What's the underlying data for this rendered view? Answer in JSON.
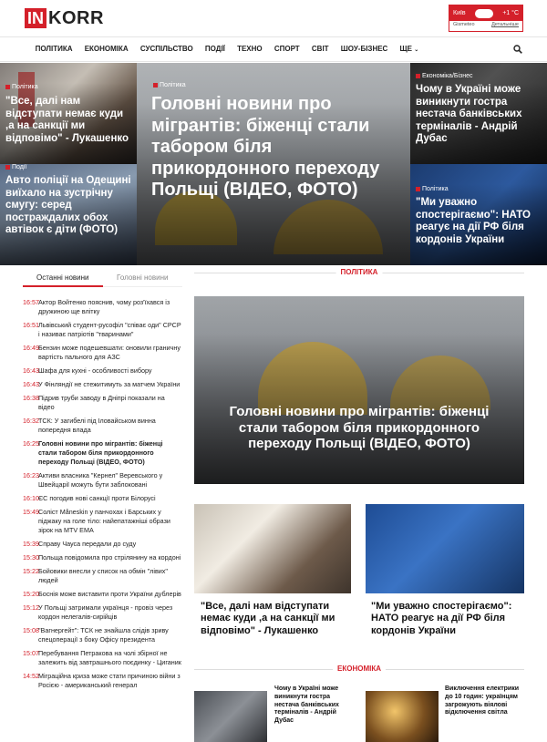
{
  "header": {
    "logo_in": "IN",
    "logo_korr": "KORR",
    "weather": {
      "city": "Київ",
      "temp": "+1 °C",
      "source": "Gismeteo",
      "more": "Детальніше"
    }
  },
  "nav": {
    "items": [
      "ПОЛІТИКА",
      "ЕКОНОМІКА",
      "СУСПІЛЬСТВО",
      "ПОДІЇ",
      "ТЕХНО",
      "СПОРТ",
      "СВІТ",
      "ШОУ-БІЗНЕС",
      "ЩЕ"
    ]
  },
  "hero": {
    "left_top": {
      "tag": "Політика",
      "title": "\"Все, далі нам відступати немає куди ,а на санкції ми відповімо\" - Лукашенко"
    },
    "left_bottom": {
      "tag": "Події",
      "title": "Авто поліції на Одещині виїхало на зустрічну смугу: серед постраждалих обох автівок є діти (ФОТО)"
    },
    "center": {
      "tag": "Політика",
      "title": "Головні новини про мігрантів: біженці стали табором біля прикордонного переходу Польщі (ВІДЕО, ФОТО)"
    },
    "right_top": {
      "tag": "Економіка/Бізнес",
      "title": "Чому в Україні може виникнути гостра нестача банківських терміналів - Андрій Дубас"
    },
    "right_bottom": {
      "tag": "Політика",
      "title": "\"Ми уважно спостерігаємо\": НАТО реагує на дії РФ біля кордонів України"
    }
  },
  "tabs": {
    "latest": "Останні новини",
    "main": "Головні новини"
  },
  "latest_news": [
    {
      "time": "16:57",
      "text": "Актор Войтенко пояснив, чому роз'їхався із дружиною ще влітку",
      "bold": false
    },
    {
      "time": "16:51",
      "text": "Львівський студент-русофіл \"співає оди\" СРСР і називає патріотів \"тваринами\"",
      "bold": false
    },
    {
      "time": "16:49",
      "text": "Бензин може подешевшати: оновили граничну вартість пального для АЗС",
      "bold": false
    },
    {
      "time": "16:43",
      "text": "Шафа для кухні - особливості вибору",
      "bold": false
    },
    {
      "time": "16:43",
      "text": "У Фінляндії не стежитимуть за матчем України",
      "bold": false
    },
    {
      "time": "16:38",
      "text": "Підрив труби заводу в Дніпрі показали на відео",
      "bold": false
    },
    {
      "time": "16:32",
      "text": "ТСК: У загибелі під Іловайськом винна попередня влада",
      "bold": false
    },
    {
      "time": "16:25",
      "text": "Головні новини про мігрантів: біженці стали табором біля прикордонного переходу Польщі (ВІДЕО, ФОТО)",
      "bold": true
    },
    {
      "time": "16:23",
      "text": "Активи власника \"Кернел\" Веревського у Швейцарії можуть бути заблоковані",
      "bold": false
    },
    {
      "time": "16:10",
      "text": "ЄС погодив нові санкції проти Білорусі",
      "bold": false
    },
    {
      "time": "15:49",
      "text": "Соліст Måneskin у панчохах і Барських у піджаку на голе тіло: найепатажніші образи зірок на MTV EMA",
      "bold": false
    },
    {
      "time": "15:39",
      "text": "Справу Чауса передали до суду",
      "bold": false
    },
    {
      "time": "15:30",
      "text": "Польща повідомила про стрілянину на кордоні",
      "bold": false
    },
    {
      "time": "15:22",
      "text": "Бойовики внесли у список на обмін \"лівих\" людей",
      "bold": false
    },
    {
      "time": "15:20",
      "text": "Боснія може виставити проти України дублерів",
      "bold": false
    },
    {
      "time": "15:12",
      "text": "У Польщі затримали українця - провіз через кордон нелегалів-сирійців",
      "bold": false
    },
    {
      "time": "15:08",
      "text": "\"Вагнергейт\": ТСК не знайшла слідів зриву спецоперації з боку Офісу президента",
      "bold": false
    },
    {
      "time": "15:07",
      "text": "Перебування Петракова на чолі збірної не залежить від завтрашнього поєдинку - Циганик",
      "bold": false
    },
    {
      "time": "14:52",
      "text": "Міграційна криза може стати причиною війни з Росією - американський генерал",
      "bold": false
    }
  ],
  "sections": {
    "politics": {
      "label": "ПОЛІТИКА",
      "main_title": "Головні новини про мігрантів: біженці стали табором біля прикордонного переходу Польщі (ВІДЕО, ФОТО)",
      "card1": "\"Все, далі нам відступати немає куди ,а на санкції ми відповімо\" - Лукашенко",
      "card2": "\"Ми уважно спостерігаємо\": НАТО реагує на дії РФ біля кордонів України"
    },
    "economy": {
      "label": "ЕКОНОМІКА",
      "item1": "Чому в Україні може виникнути гостра нестача банківських терміналів - Андрій Дубас",
      "item2": "Виключення електрики до 10 годин: українцям загрожують віялові відключення світла"
    }
  },
  "colors": {
    "accent": "#d4202a"
  }
}
